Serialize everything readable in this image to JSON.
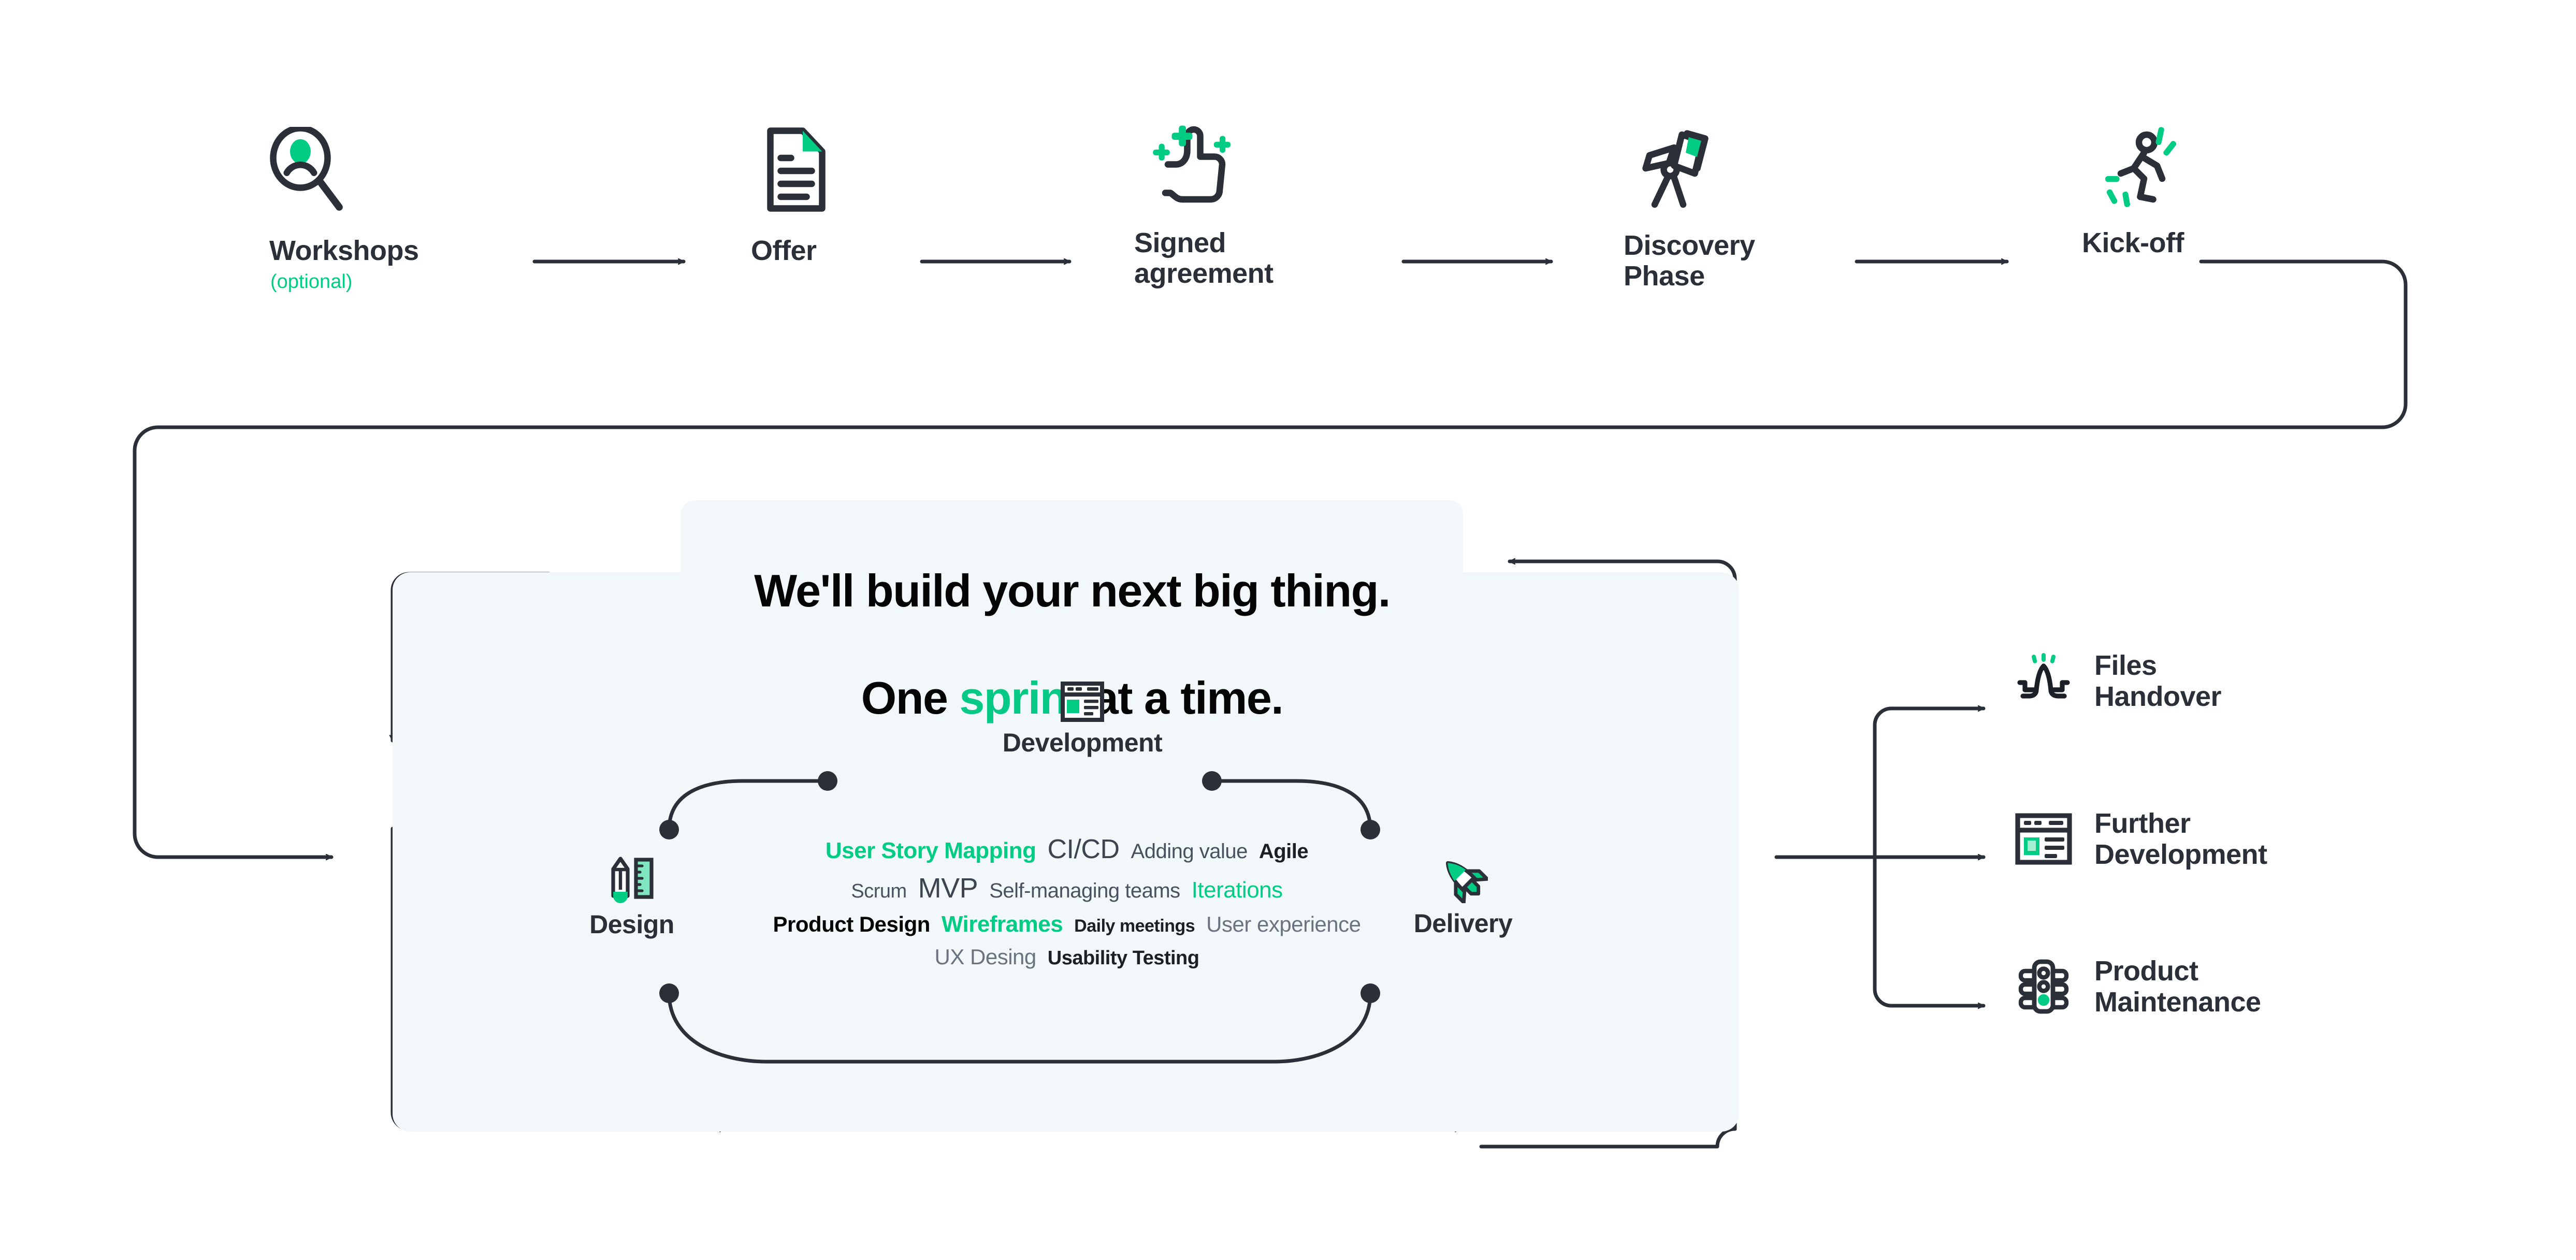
{
  "colors": {
    "accent_green": "#00CC84",
    "dark": "#2B3038",
    "gray": "#59606E",
    "black": "#050505",
    "panel_bg": "#F2F7F9",
    "line": "#2B3038"
  },
  "process_steps": [
    {
      "label": "Workshops",
      "sublabel": "(optional)",
      "icon": "magnifier-person-icon"
    },
    {
      "label": "Offer",
      "sublabel": "",
      "icon": "document-icon"
    },
    {
      "label": "Signed\nagreement",
      "sublabel": "",
      "icon": "thumbs-up-icon"
    },
    {
      "label": "Discovery\nPhase",
      "sublabel": "",
      "icon": "telescope-icon"
    },
    {
      "label": "Kick-off",
      "sublabel": "",
      "icon": "running-person-icon"
    }
  ],
  "headline": {
    "line1": "We'll build your next big thing.",
    "line2_pre": "One ",
    "line2_accent": "sprint",
    "line2_post": " at a time."
  },
  "sprint_cycle": [
    {
      "label": "Development",
      "icon": "browser-window-icon"
    },
    {
      "label": "Design",
      "icon": "pencil-ruler-icon"
    },
    {
      "label": "Delivery",
      "icon": "rocket-icon"
    }
  ],
  "word_cloud": {
    "rows": [
      [
        {
          "text": "User Story Mapping",
          "color": "#00CC84",
          "size": 44,
          "weight": "bold"
        },
        {
          "text": "CI/CD",
          "color": "#3D4450",
          "size": 52,
          "weight": "normal"
        },
        {
          "text": "Adding value",
          "color": "#4A515E",
          "size": 40,
          "weight": "normal"
        },
        {
          "text": "Agile",
          "color": "#1B1F26",
          "size": 40,
          "weight": "bold"
        }
      ],
      [
        {
          "text": "Scrum",
          "color": "#4A515E",
          "size": 38,
          "weight": "normal"
        },
        {
          "text": "MVP",
          "color": "#3D4450",
          "size": 54,
          "weight": "normal"
        },
        {
          "text": "Self-managing teams",
          "color": "#4A515E",
          "size": 40,
          "weight": "normal"
        },
        {
          "text": "Iterations",
          "color": "#00CC84",
          "size": 44,
          "weight": "normal"
        }
      ],
      [
        {
          "text": "Product Design",
          "color": "#050505",
          "size": 42,
          "weight": "bold"
        },
        {
          "text": "Wireframes",
          "color": "#00CC84",
          "size": 44,
          "weight": "bold"
        },
        {
          "text": "Daily meetings",
          "color": "#1B1F26",
          "size": 34,
          "weight": "bold"
        },
        {
          "text": "User experience",
          "color": "#6C7280",
          "size": 42,
          "weight": "normal"
        }
      ],
      [
        {
          "text": "UX Desing",
          "color": "#6C7280",
          "size": 42,
          "weight": "normal"
        },
        {
          "text": "Usability Testing",
          "color": "#1B1F26",
          "size": 38,
          "weight": "bold"
        }
      ]
    ]
  },
  "outputs": [
    {
      "label": "Files\nHandover",
      "icon": "handover-hands-icon"
    },
    {
      "label": "Further\nDevelopment",
      "icon": "browser-window-icon"
    },
    {
      "label": "Product\nMaintenance",
      "icon": "traffic-light-icon"
    }
  ]
}
